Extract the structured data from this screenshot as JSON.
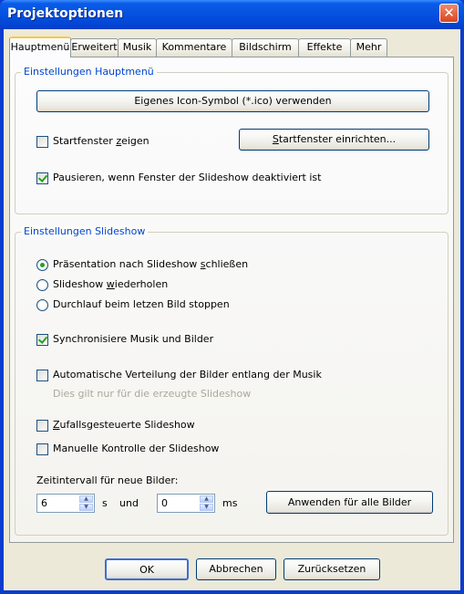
{
  "window": {
    "title": "Projektoptionen",
    "close_glyph": "✕"
  },
  "tabs": [
    "Hauptmenü",
    "Erweitert",
    "Musik",
    "Kommentare",
    "Bildschirm",
    "Effekte",
    "Mehr"
  ],
  "main_group": {
    "legend": "Einstellungen Hauptmenü",
    "icon_button": "Eigenes Icon-Symbol (*.ico) verwenden",
    "startfenster_label_pre": "Startfenster ",
    "startfenster_label_u": "z",
    "startfenster_label_post": "eigen",
    "startfenster_checked": false,
    "startfenster_button_u": "S",
    "startfenster_button_rest": "tartfenster einrichten...",
    "pause_label": "Pausieren, wenn Fenster der Slideshow deaktiviert ist",
    "pause_checked": true
  },
  "slideshow_group": {
    "legend": "Einstellungen Slideshow",
    "radio1_pre": "Präsentation nach Slideshow ",
    "radio1_u": "s",
    "radio1_post": "chließen",
    "radio2_pre": "Slideshow ",
    "radio2_u": "w",
    "radio2_post": "iederholen",
    "radio3": "Durchlauf beim letzen Bild stoppen",
    "radio_selected": 1,
    "sync_label": "Synchronisiere Musik und Bilder",
    "sync_checked": true,
    "auto_label": "Automatische Verteilung der Bilder entlang der Musik",
    "auto_checked": false,
    "auto_hint": "Dies gilt nur für die erzeugte Slideshow",
    "random_u": "Z",
    "random_rest": "ufallsgesteuerte Slideshow",
    "random_checked": false,
    "manual_label": "Manuelle Kontrolle der Slideshow",
    "manual_checked": false,
    "interval_label": "Zeitintervall für neue Bilder:",
    "seconds_value": "6",
    "seconds_unit": "s",
    "and_label": "und",
    "ms_value": "0",
    "ms_unit": "ms",
    "apply_button": "Anwenden für alle Bilder"
  },
  "footer": {
    "ok": "OK",
    "cancel": "Abbrechen",
    "reset": "Zurücksetzen"
  }
}
